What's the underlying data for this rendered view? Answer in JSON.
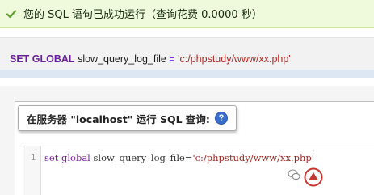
{
  "success_banner": {
    "message": "您的 SQL 语句已成功运行（查询花费 0.0000 秒）",
    "icon": "check-icon"
  },
  "sql_preview": {
    "kw_set": "SET",
    "kw_global": "GLOBAL",
    "variable": "slow_query_log_file",
    "operator": "=",
    "value": "'c:/phpstudy/www/xx.php'"
  },
  "query_panel": {
    "legend": "在服务器 \"localhost\" 运行 SQL 查询:",
    "help_icon": "question-icon",
    "help_glyph": "?"
  },
  "editor": {
    "line_number": "1",
    "kw_set": "set",
    "kw_global": "global",
    "variable": "slow_query_log_file=",
    "value": "'c:/phpstudy/www/xx.php'"
  },
  "colors": {
    "success_bg": "#eefadb",
    "keyword": "#6b1fa0",
    "string": "#b52525",
    "help_icon": "#3a6fd0"
  }
}
